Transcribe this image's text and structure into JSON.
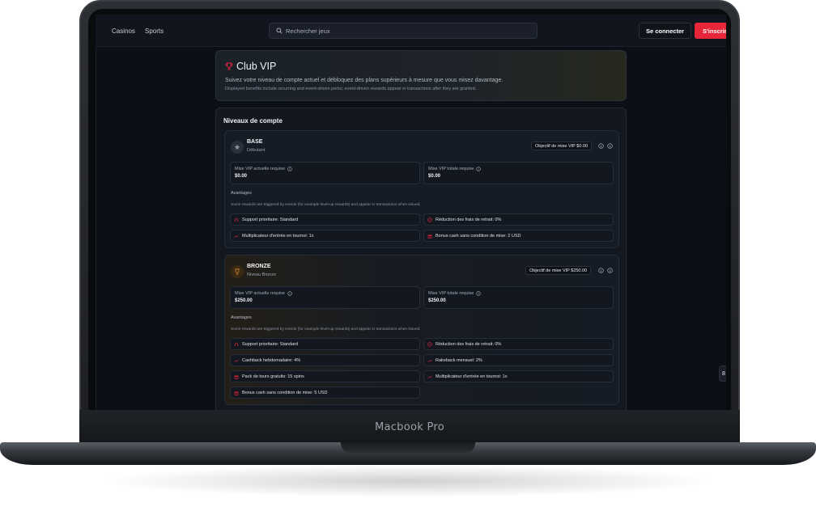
{
  "device": {
    "label": "Macbook Pro"
  },
  "nav": {
    "links": [
      "Casinos",
      "Sports"
    ],
    "search_placeholder": "Rechercher jeux",
    "login": "Se connecter",
    "signup": "S'inscrire"
  },
  "hero": {
    "title": "Club VIP",
    "subtitle": "Suivez votre niveau de compte actuel et débloquez des plans supérieurs à mesure que vous misez davantage.",
    "note": "Displayed benefits include recurring and event-driven perks; event-driven rewards appear in transactions after they are granted."
  },
  "levels": {
    "title": "Niveaux de compte",
    "tiers": [
      {
        "name": "BASE",
        "subtitle": "Débutant",
        "goal": "Objectif de mise VIP $0.00",
        "current_label": "Mise VIP actuelle requise",
        "current_value": "$0.00",
        "total_label": "Mise VIP totale requise",
        "total_value": "$0.00",
        "advantages_label": "Avantages",
        "advantages_note": "Some rewards are triggered by events (for example level-up rewards) and appear in transactions when issued.",
        "perks": [
          "Support prioritaire: Standard",
          "Réduction des frais de retrait: 0%",
          "Multiplicateur d'entrée en tournoi: 1x",
          "Bonus cash sans condition de mise: 2 USD"
        ]
      },
      {
        "name": "BRONZE",
        "subtitle": "Niveau Bronze",
        "goal": "Objectif de mise VIP $250.00",
        "current_label": "Mise VIP actuelle requise",
        "current_value": "$250.00",
        "total_label": "Mise VIP totale requise",
        "total_value": "$250.00",
        "advantages_label": "Avantages",
        "advantages_note": "Some rewards are triggered by events (for example level-up rewards) and appear in transactions when issued.",
        "perks": [
          "Support prioritaire: Standard",
          "Réduction des frais de retrait: 0%",
          "Cashback hebdomadaire: 4%",
          "Rakeback mensuel: 2%",
          "Pack de tours gratuits: 15 spins",
          "Multiplicateur d'entrée en tournoi: 1x",
          "Bonus cash sans condition de mise: 5 USD"
        ]
      }
    ]
  },
  "side_tab": {
    "label": "8"
  },
  "colors": {
    "accent": "#e8263a",
    "background": "#0c0f15",
    "card": "#161c25"
  }
}
